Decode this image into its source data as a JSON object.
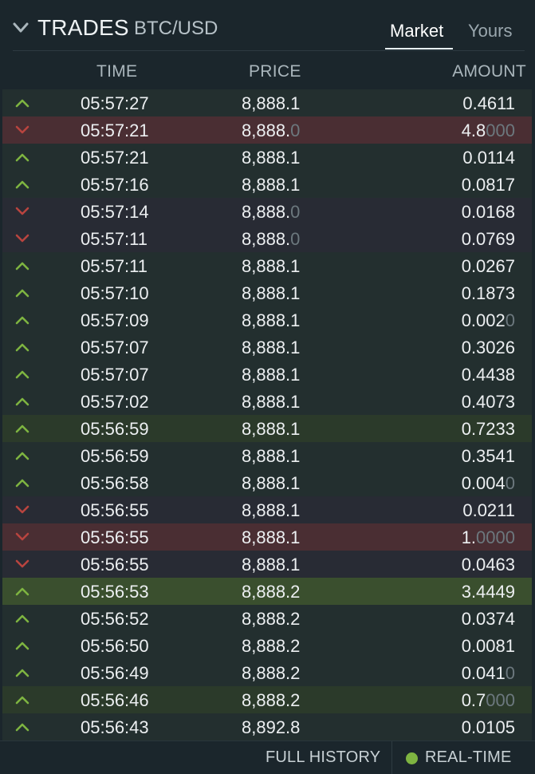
{
  "header": {
    "title": "TRADES",
    "pair": "BTC/USD"
  },
  "tabs": {
    "market": "Market",
    "yours": "Yours",
    "active": "market"
  },
  "columns": {
    "time": "TIME",
    "price": "PRICE",
    "amount": "AMOUNT"
  },
  "colors": {
    "up_arrow": "#7eb441",
    "down_arrow": "#b8443f",
    "live_dot": "#7eb441"
  },
  "trades": [
    {
      "dir": "up",
      "hl": "",
      "time": "05:57:27",
      "price": "8,888.1",
      "price_dim": "",
      "amount": "0.4611",
      "amount_dim": ""
    },
    {
      "dir": "down",
      "hl": "hl",
      "time": "05:57:21",
      "price": "8,888.",
      "price_dim": "0",
      "amount": "4.8",
      "amount_dim": "000"
    },
    {
      "dir": "up",
      "hl": "",
      "time": "05:57:21",
      "price": "8,888.1",
      "price_dim": "",
      "amount": "0.0114",
      "amount_dim": ""
    },
    {
      "dir": "up",
      "hl": "",
      "time": "05:57:16",
      "price": "8,888.1",
      "price_dim": "",
      "amount": "0.0817",
      "amount_dim": ""
    },
    {
      "dir": "down",
      "hl": "",
      "time": "05:57:14",
      "price": "8,888.",
      "price_dim": "0",
      "amount": "0.0168",
      "amount_dim": ""
    },
    {
      "dir": "down",
      "hl": "",
      "time": "05:57:11",
      "price": "8,888.",
      "price_dim": "0",
      "amount": "0.0769",
      "amount_dim": ""
    },
    {
      "dir": "up",
      "hl": "",
      "time": "05:57:11",
      "price": "8,888.1",
      "price_dim": "",
      "amount": "0.0267",
      "amount_dim": ""
    },
    {
      "dir": "up",
      "hl": "",
      "time": "05:57:10",
      "price": "8,888.1",
      "price_dim": "",
      "amount": "0.1873",
      "amount_dim": ""
    },
    {
      "dir": "up",
      "hl": "",
      "time": "05:57:09",
      "price": "8,888.1",
      "price_dim": "",
      "amount": "0.002",
      "amount_dim": "0"
    },
    {
      "dir": "up",
      "hl": "",
      "time": "05:57:07",
      "price": "8,888.1",
      "price_dim": "",
      "amount": "0.3026",
      "amount_dim": ""
    },
    {
      "dir": "up",
      "hl": "",
      "time": "05:57:07",
      "price": "8,888.1",
      "price_dim": "",
      "amount": "0.4438",
      "amount_dim": ""
    },
    {
      "dir": "up",
      "hl": "",
      "time": "05:57:02",
      "price": "8,888.1",
      "price_dim": "",
      "amount": "0.4073",
      "amount_dim": ""
    },
    {
      "dir": "up",
      "hl": "hl",
      "time": "05:56:59",
      "price": "8,888.1",
      "price_dim": "",
      "amount": "0.7233",
      "amount_dim": ""
    },
    {
      "dir": "up",
      "hl": "",
      "time": "05:56:59",
      "price": "8,888.1",
      "price_dim": "",
      "amount": "0.3541",
      "amount_dim": ""
    },
    {
      "dir": "up",
      "hl": "",
      "time": "05:56:58",
      "price": "8,888.1",
      "price_dim": "",
      "amount": "0.004",
      "amount_dim": "0"
    },
    {
      "dir": "down",
      "hl": "",
      "time": "05:56:55",
      "price": "8,888.1",
      "price_dim": "",
      "amount": "0.0211",
      "amount_dim": ""
    },
    {
      "dir": "down",
      "hl": "hl",
      "time": "05:56:55",
      "price": "8,888.1",
      "price_dim": "",
      "amount": "1.",
      "amount_dim": "0000"
    },
    {
      "dir": "down",
      "hl": "",
      "time": "05:56:55",
      "price": "8,888.1",
      "price_dim": "",
      "amount": "0.0463",
      "amount_dim": ""
    },
    {
      "dir": "up",
      "hl": "hl2",
      "time": "05:56:53",
      "price": "8,888.2",
      "price_dim": "",
      "amount": "3.4449",
      "amount_dim": ""
    },
    {
      "dir": "up",
      "hl": "",
      "time": "05:56:52",
      "price": "8,888.2",
      "price_dim": "",
      "amount": "0.0374",
      "amount_dim": ""
    },
    {
      "dir": "up",
      "hl": "",
      "time": "05:56:50",
      "price": "8,888.2",
      "price_dim": "",
      "amount": "0.0081",
      "amount_dim": ""
    },
    {
      "dir": "up",
      "hl": "",
      "time": "05:56:49",
      "price": "8,888.2",
      "price_dim": "",
      "amount": "0.041",
      "amount_dim": "0"
    },
    {
      "dir": "up",
      "hl": "hl",
      "time": "05:56:46",
      "price": "8,888.2",
      "price_dim": "",
      "amount": "0.7",
      "amount_dim": "000"
    },
    {
      "dir": "up",
      "hl": "",
      "time": "05:56:43",
      "price": "8,892.8",
      "price_dim": "",
      "amount": "0.0105",
      "amount_dim": ""
    }
  ],
  "footer": {
    "history": "FULL HISTORY",
    "realtime": "REAL-TIME"
  }
}
